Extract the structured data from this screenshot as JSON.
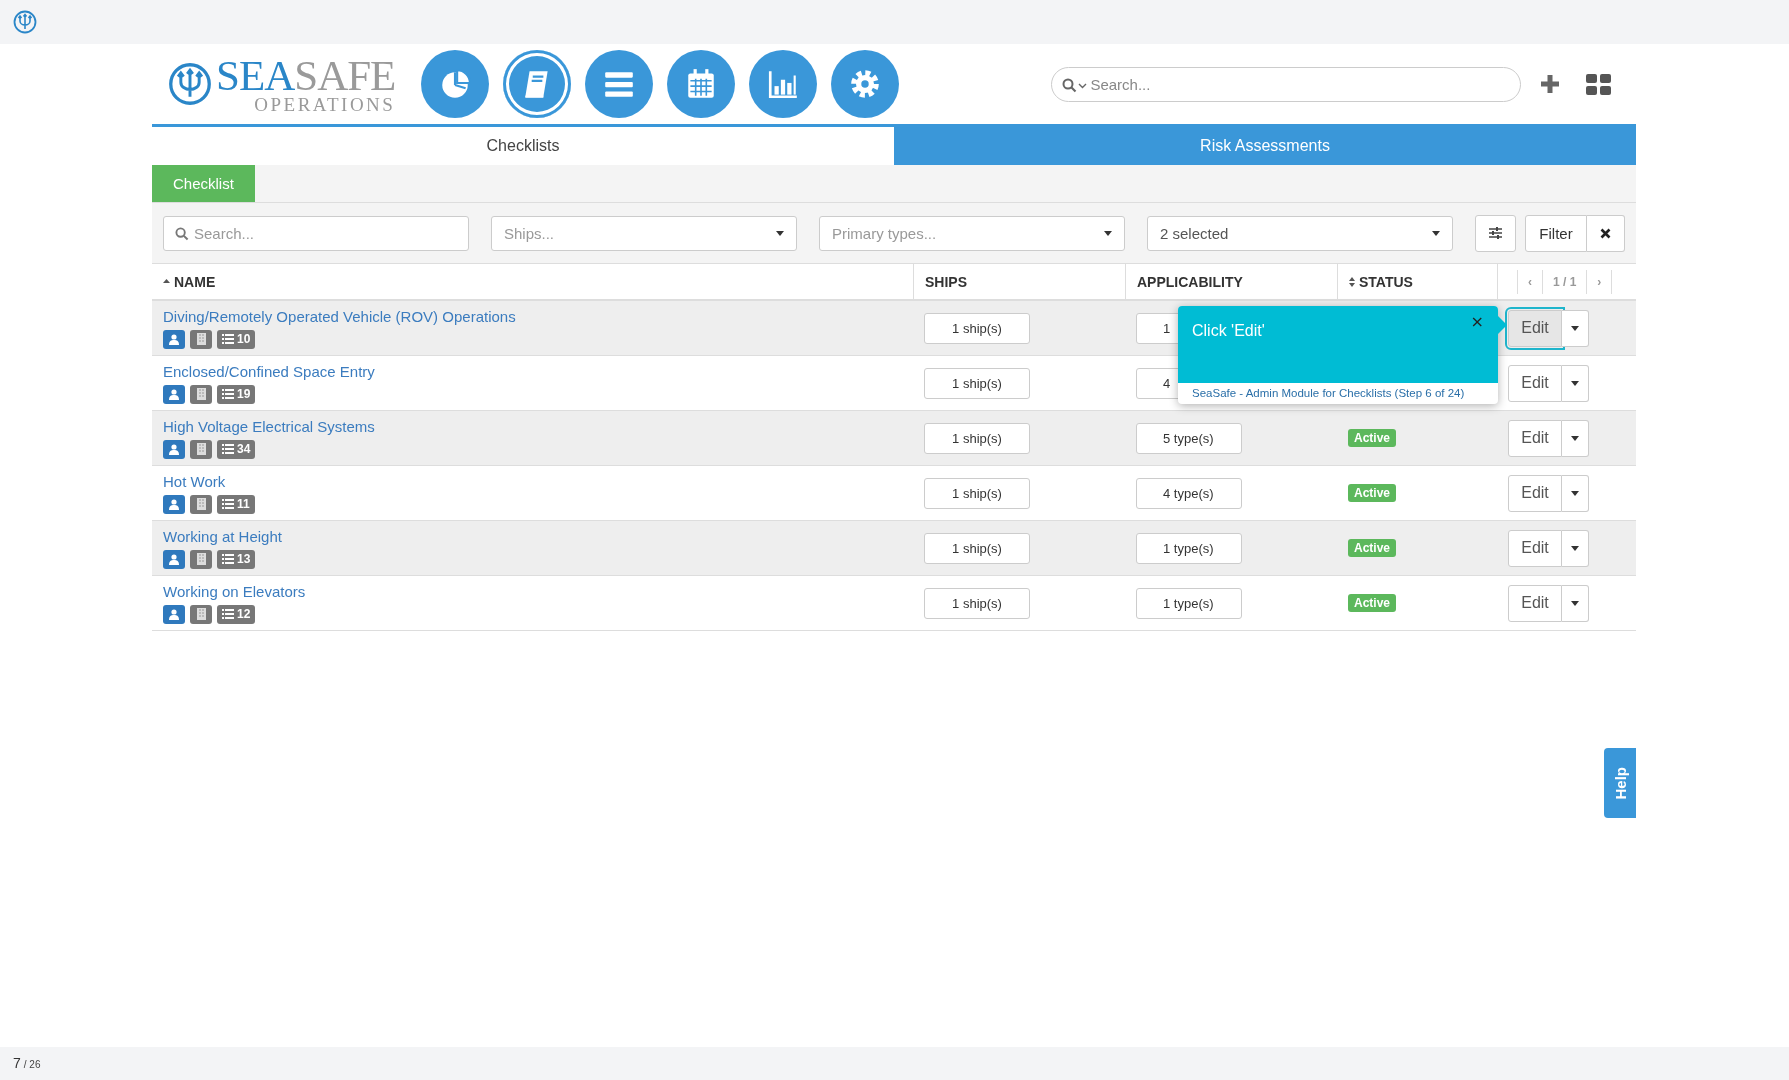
{
  "header": {
    "logo": {
      "first": "SEA",
      "second": "SAFE",
      "subtitle": "OPERATIONS"
    },
    "nav": [
      {
        "kind": "pie",
        "selected": false
      },
      {
        "kind": "book",
        "selected": true
      },
      {
        "kind": "menu",
        "selected": false
      },
      {
        "kind": "calendar",
        "selected": false
      },
      {
        "kind": "chart",
        "selected": false
      },
      {
        "kind": "gear",
        "selected": false
      }
    ],
    "search": {
      "placeholder": "Search..."
    }
  },
  "tabs": [
    {
      "label": "Checklists",
      "selected": true
    },
    {
      "label": "Risk Assessments",
      "selected": false
    }
  ],
  "subtabs": [
    {
      "label": "Checklist",
      "selected": true
    }
  ],
  "filters": {
    "search": {
      "placeholder": "Search..."
    },
    "selects": [
      {
        "placeholder": "Ships..."
      },
      {
        "placeholder": "Primary types..."
      },
      {
        "value": "2 selected"
      }
    ],
    "filter_button": "Filter"
  },
  "table": {
    "columns": [
      {
        "label": "NAME",
        "sorted": true
      },
      {
        "label": "SHIPS"
      },
      {
        "label": "APPLICABILITY"
      },
      {
        "label": "STATUS",
        "sorted": false,
        "sortable": true
      }
    ],
    "pagination": {
      "prev": "‹",
      "page": "1 / 1",
      "next": "›"
    },
    "rows": [
      {
        "name": "Diving/Remotely Operated Vehicle (ROV) Operations",
        "count": "10",
        "ships": "1 ship(s)",
        "applicability": "1",
        "edit": {
          "label": "Edit",
          "highlighted": true
        }
      },
      {
        "name": "Enclosed/Confined Space Entry",
        "count": "19",
        "ships": "1 ship(s)",
        "applicability": "4",
        "edit": {
          "label": "Edit",
          "highlighted": false
        }
      },
      {
        "name": "High Voltage Electrical Systems",
        "count": "34",
        "ships": "1 ship(s)",
        "applicability": "5 type(s)",
        "status": "Active",
        "edit": {
          "label": "Edit",
          "highlighted": false
        }
      },
      {
        "name": "Hot Work",
        "count": "11",
        "ships": "1 ship(s)",
        "applicability": "4 type(s)",
        "status": "Active",
        "edit": {
          "label": "Edit",
          "highlighted": false
        }
      },
      {
        "name": "Working at Height",
        "count": "13",
        "ships": "1 ship(s)",
        "applicability": "1 type(s)",
        "status": "Active",
        "edit": {
          "label": "Edit",
          "highlighted": false
        }
      },
      {
        "name": "Working on Elevators",
        "count": "12",
        "ships": "1 ship(s)",
        "applicability": "1 type(s)",
        "status": "Active",
        "edit": {
          "label": "Edit",
          "highlighted": false
        }
      }
    ]
  },
  "tour": {
    "title": "Click 'Edit'",
    "close": "×",
    "footer": "SeaSafe - Admin Module for Checklists (Step 6 of 24)"
  },
  "help": {
    "label": "Help"
  },
  "footer": {
    "page": "7",
    "total": "/ 26"
  }
}
